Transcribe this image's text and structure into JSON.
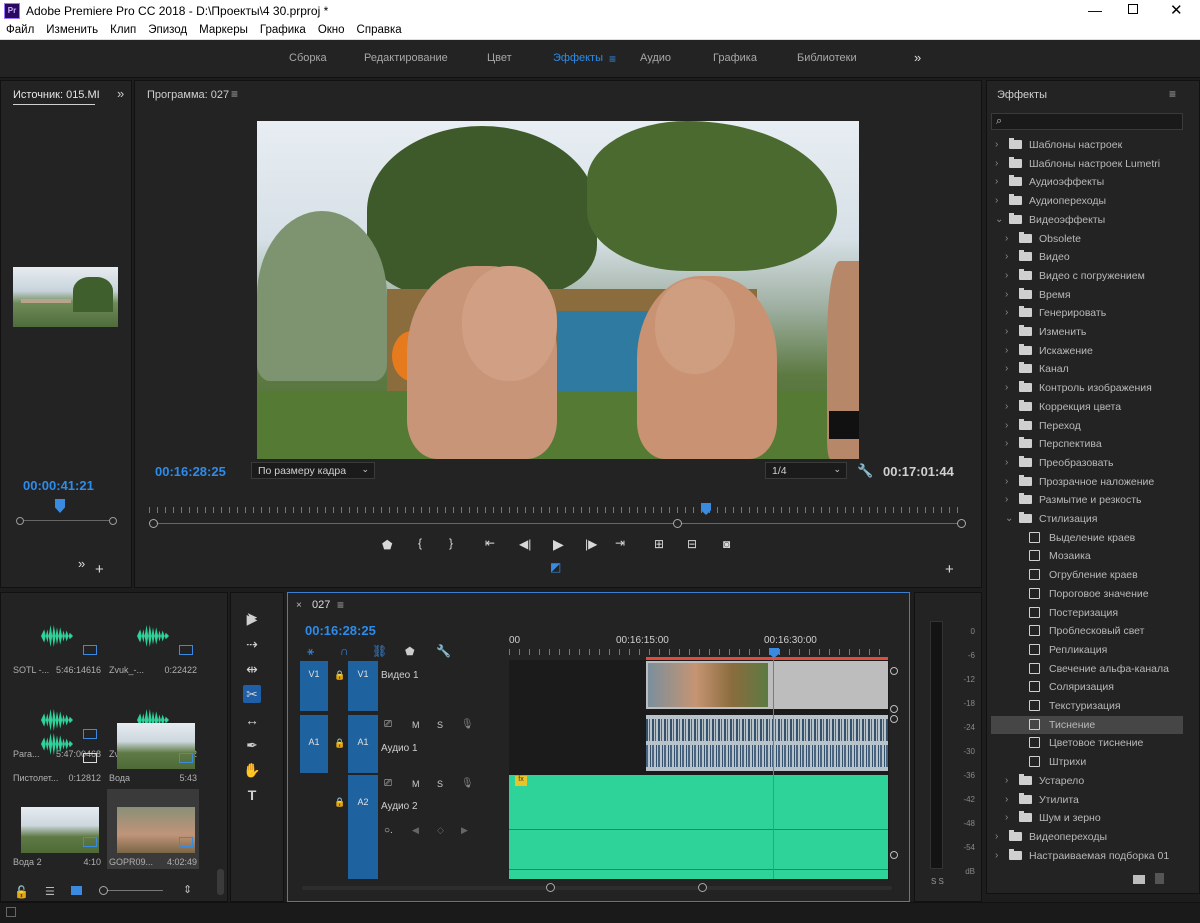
{
  "window": {
    "title": "Adobe Premiere Pro CC 2018 - D:\\Проекты\\4 30.prproj *",
    "app_icon": "Pr"
  },
  "menu": [
    "Файл",
    "Изменить",
    "Клип",
    "Эпизод",
    "Маркеры",
    "Графика",
    "Окно",
    "Справка"
  ],
  "workspaces": [
    "Сборка",
    "Редактирование",
    "Цвет",
    "Эффекты",
    "Аудио",
    "Графика",
    "Библиотеки"
  ],
  "workspace_active": "Эффекты",
  "source": {
    "title": "Источник: 015.MI",
    "timecode": "00:00:41:21"
  },
  "program": {
    "title": "Программа: 027",
    "timecode_left": "00:16:28:25",
    "fit": "По размеру кадра",
    "resolution": "1/4",
    "timecode_right": "00:17:01:44"
  },
  "effects": {
    "title": "Эффекты",
    "items": [
      {
        "label": "Шаблоны настроек",
        "level": 0,
        "kind": "special",
        "open": false
      },
      {
        "label": "Шаблоны настроек Lumetri",
        "level": 0,
        "kind": "special",
        "open": false
      },
      {
        "label": "Аудиоэффекты",
        "level": 0,
        "kind": "folder",
        "open": false
      },
      {
        "label": "Аудиопереходы",
        "level": 0,
        "kind": "folder",
        "open": false
      },
      {
        "label": "Видеоэффекты",
        "level": 0,
        "kind": "folder",
        "open": true
      },
      {
        "label": "Obsolete",
        "level": 1,
        "kind": "folder",
        "open": false
      },
      {
        "label": "Видео",
        "level": 1,
        "kind": "folder",
        "open": false
      },
      {
        "label": "Видео с погружением",
        "level": 1,
        "kind": "folder",
        "open": false
      },
      {
        "label": "Время",
        "level": 1,
        "kind": "folder",
        "open": false
      },
      {
        "label": "Генерировать",
        "level": 1,
        "kind": "folder",
        "open": false
      },
      {
        "label": "Изменить",
        "level": 1,
        "kind": "folder",
        "open": false
      },
      {
        "label": "Искажение",
        "level": 1,
        "kind": "folder",
        "open": false
      },
      {
        "label": "Канал",
        "level": 1,
        "kind": "folder",
        "open": false
      },
      {
        "label": "Контроль изображения",
        "level": 1,
        "kind": "folder",
        "open": false
      },
      {
        "label": "Коррекция цвета",
        "level": 1,
        "kind": "folder",
        "open": false
      },
      {
        "label": "Переход",
        "level": 1,
        "kind": "folder",
        "open": false
      },
      {
        "label": "Перспектива",
        "level": 1,
        "kind": "folder",
        "open": false
      },
      {
        "label": "Преобразовать",
        "level": 1,
        "kind": "folder",
        "open": false
      },
      {
        "label": "Прозрачное наложение",
        "level": 1,
        "kind": "folder",
        "open": false
      },
      {
        "label": "Размытие и резкость",
        "level": 1,
        "kind": "folder",
        "open": false
      },
      {
        "label": "Стилизация",
        "level": 1,
        "kind": "folder",
        "open": true
      },
      {
        "label": "Выделение краев",
        "level": 2,
        "kind": "effect"
      },
      {
        "label": "Мозаика",
        "level": 2,
        "kind": "effect"
      },
      {
        "label": "Огрубление краев",
        "level": 2,
        "kind": "effect"
      },
      {
        "label": "Пороговое значение",
        "level": 2,
        "kind": "effect"
      },
      {
        "label": "Постеризация",
        "level": 2,
        "kind": "effect"
      },
      {
        "label": "Проблесковый свет",
        "level": 2,
        "kind": "effect"
      },
      {
        "label": "Репликация",
        "level": 2,
        "kind": "effect"
      },
      {
        "label": "Свечение альфа-канала",
        "level": 2,
        "kind": "effect"
      },
      {
        "label": "Соляризация",
        "level": 2,
        "kind": "effect"
      },
      {
        "label": "Текстуризация",
        "level": 2,
        "kind": "effect"
      },
      {
        "label": "Тиснение",
        "level": 2,
        "kind": "effect",
        "selected": true
      },
      {
        "label": "Цветовое тиснение",
        "level": 2,
        "kind": "effect"
      },
      {
        "label": "Штрихи",
        "level": 2,
        "kind": "effect"
      },
      {
        "label": "Устарело",
        "level": 1,
        "kind": "folder",
        "open": false
      },
      {
        "label": "Утилита",
        "level": 1,
        "kind": "folder",
        "open": false
      },
      {
        "label": "Шум и зерно",
        "level": 1,
        "kind": "folder",
        "open": false
      },
      {
        "label": "Видеопереходы",
        "level": 0,
        "kind": "folder",
        "open": false
      },
      {
        "label": "Настраиваемая подборка 01",
        "level": 0,
        "kind": "folder",
        "open": false
      }
    ]
  },
  "project_bin": [
    {
      "name": "SOTL -...",
      "dur": "5:46:14616",
      "kind": "audio"
    },
    {
      "name": "Zvuk_-...",
      "dur": "0:22422",
      "kind": "audio"
    },
    {
      "name": "Para...",
      "dur": "5:47:00468",
      "kind": "audio"
    },
    {
      "name": "Zvuk_-_P...",
      "dur": "0:12812",
      "kind": "audio"
    },
    {
      "name": "Пистолет...",
      "dur": "0:12812",
      "kind": "audio"
    },
    {
      "name": "Вода",
      "dur": "5:43",
      "kind": "video"
    },
    {
      "name": "Вода 2",
      "dur": "4:10",
      "kind": "video"
    },
    {
      "name": "GOPR09...",
      "dur": "4:02:49",
      "kind": "video"
    }
  ],
  "timeline": {
    "tab": "027",
    "timecode": "00:16:28:25",
    "ruler": [
      "00",
      "00:16:15:00",
      "00:16:30:00"
    ],
    "tracks": {
      "v1": "V1",
      "v1_label": "Видео 1",
      "a1": "A1",
      "a1_label": "Аудио 1",
      "a2": "A2",
      "a2_label": "Аудио 2",
      "m": "M",
      "s": "S",
      "fx": "fx"
    }
  },
  "meter_scale": [
    "0",
    "-6",
    "-12",
    "-18",
    "-24",
    "-30",
    "-36",
    "-42",
    "-48",
    "-54",
    "dB"
  ],
  "meter_footer": "S S",
  "colors": {
    "accent": "#2d8ceb",
    "audio_clip": "#2ed39a",
    "track_head": "#1e62a0",
    "playhead": "#3a8be0"
  }
}
